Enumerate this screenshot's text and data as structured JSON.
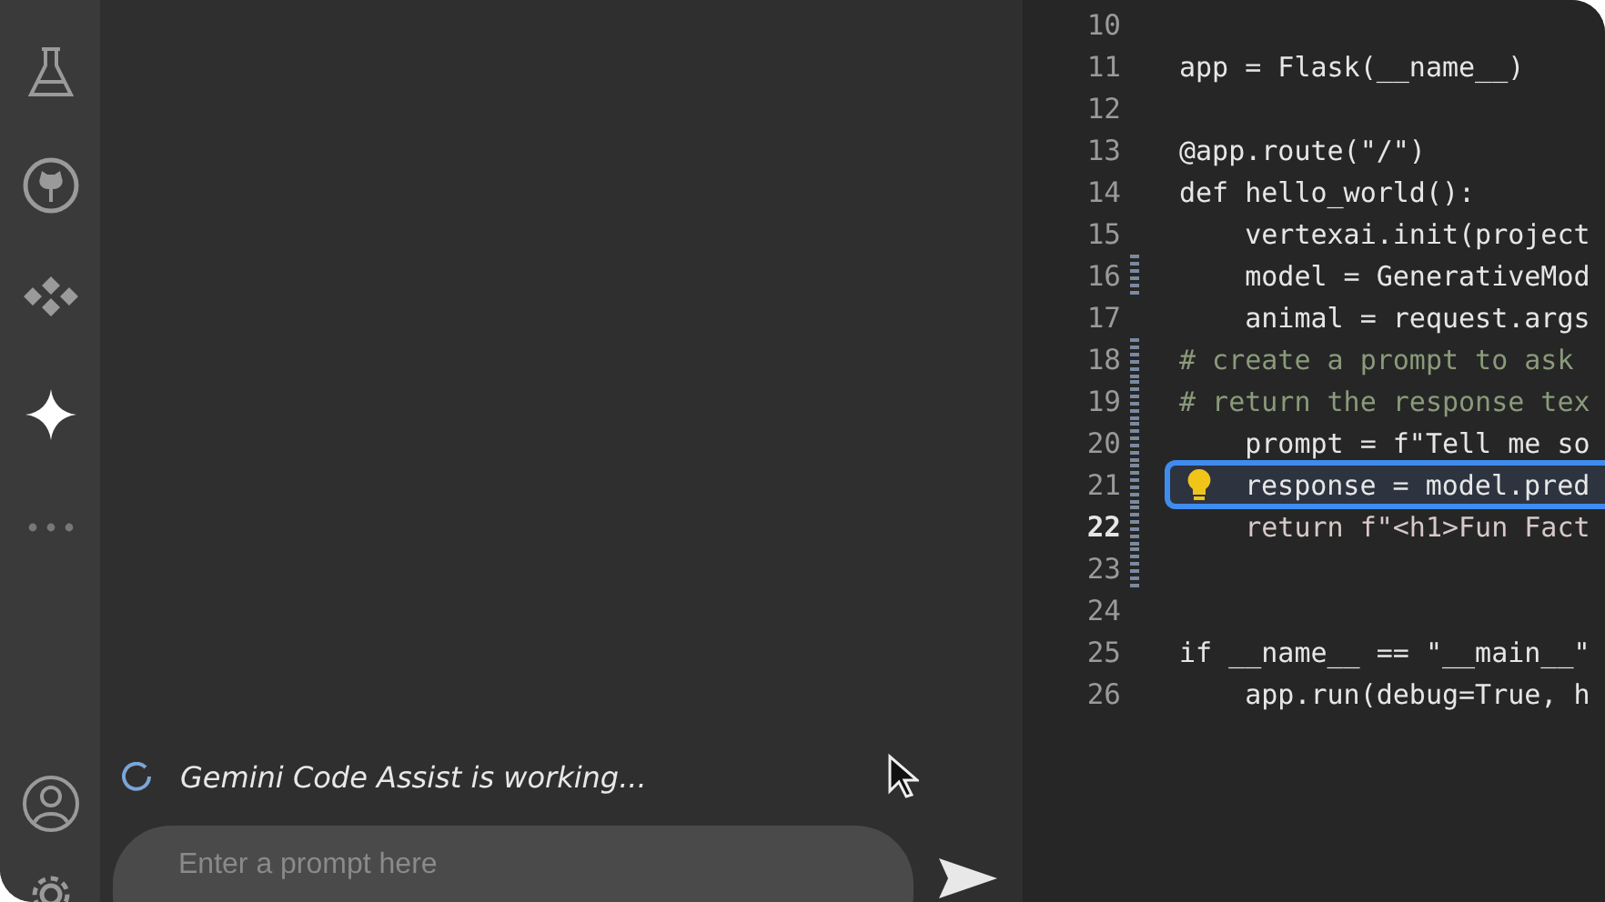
{
  "status": {
    "text": "Gemini Code Assist is working...",
    "busy": true
  },
  "prompt": {
    "placeholder": "Enter a prompt here"
  },
  "editor": {
    "lines": [
      {
        "number": "10",
        "selected": false,
        "current": false,
        "modified": false
      },
      {
        "number": "11",
        "text": "app = Flask(__name__)",
        "kind": "code",
        "selected": false,
        "current": false,
        "modified": false
      },
      {
        "number": "12",
        "selected": false,
        "current": false,
        "modified": false
      },
      {
        "number": "13",
        "text": "@app.route(\"/\")",
        "kind": "code",
        "selected": false,
        "current": false,
        "modified": false
      },
      {
        "number": "14",
        "text": "def hello_world():",
        "kind": "code",
        "selected": false,
        "current": false,
        "modified": false
      },
      {
        "number": "15",
        "text": "    vertexai.init(project",
        "kind": "code",
        "selected": false,
        "current": false,
        "modified": false
      },
      {
        "number": "16",
        "text": "    model = GenerativeMod",
        "kind": "code",
        "selected": false,
        "current": false,
        "modified": true
      },
      {
        "number": "17",
        "text": "    animal = request.args",
        "kind": "code",
        "selected": false,
        "current": false,
        "modified": false
      },
      {
        "number": "18",
        "text": "# create a prompt to ask",
        "kind": "comment",
        "selected": false,
        "current": false,
        "modified": true
      },
      {
        "number": "19",
        "text": "# return the response tex",
        "kind": "comment",
        "selected": false,
        "current": false,
        "modified": true
      },
      {
        "number": "20",
        "text": "    prompt = f\"Tell me so",
        "kind": "code",
        "selected": false,
        "current": false,
        "modified": true
      },
      {
        "number": "21",
        "text": "response = model.pred",
        "kind": "code",
        "selected": true,
        "current": false,
        "modified": true
      },
      {
        "number": "22",
        "text": "    return f\"<h1>Fun Fact",
        "kind": "code",
        "selected": false,
        "current": true,
        "modified": true
      },
      {
        "number": "23",
        "selected": false,
        "current": false,
        "modified": true
      },
      {
        "number": "24",
        "selected": false,
        "current": false,
        "modified": false
      },
      {
        "number": "25",
        "text": "if __name__ == \"__main__\"",
        "kind": "code",
        "selected": false,
        "current": false,
        "modified": false
      },
      {
        "number": "26",
        "text": "    app.run(debug=True, h",
        "kind": "code",
        "selected": false,
        "current": false,
        "modified": false
      }
    ]
  }
}
